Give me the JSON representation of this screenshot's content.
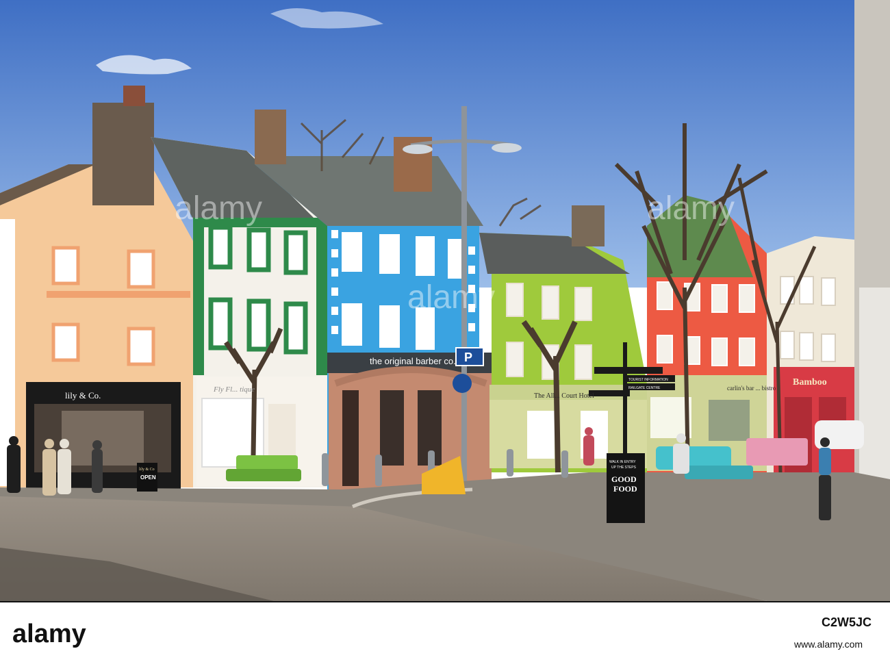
{
  "colors": {
    "sky_top": "#3f6fc4",
    "sky_bottom": "#8fb3e6",
    "peach": "#f6cc9e",
    "green_trim": "#2e8a4a",
    "blue_facade": "#3aa2e0",
    "lime": "#9fca3c",
    "red_facade": "#ee5a44",
    "bamboo_red": "#d83a44",
    "road": "#8a8176",
    "footer_black": "#111111"
  },
  "shops": {
    "lily": "lily & Co.",
    "lily_board_top": "lily & Co",
    "lily_board_open": "OPEN",
    "florist": "Fly Fl... tique",
    "barber": "the original barber co.",
    "hotel": "The All... Court Hotel",
    "carlins": "carlin's bar ... bistro",
    "bamboo": "Bamboo"
  },
  "street_signs": {
    "parking": "P",
    "fingerpost_1": "TOURIST INFORMATION",
    "fingerpost_2": "RAILGATE CENTRE"
  },
  "a_board": {
    "line1": "WALK IN ENTRY",
    "line2": "UP THE STEPS",
    "line3": "GOOD",
    "line4": "FOOD"
  },
  "watermark": {
    "text": "alamy"
  },
  "footer": {
    "logo": "alamy",
    "image_id": "C2W5JC",
    "url": "www.alamy.com"
  },
  "icons": [
    "parking-sign-icon",
    "street-lamp-icon",
    "fingerpost-icon"
  ]
}
